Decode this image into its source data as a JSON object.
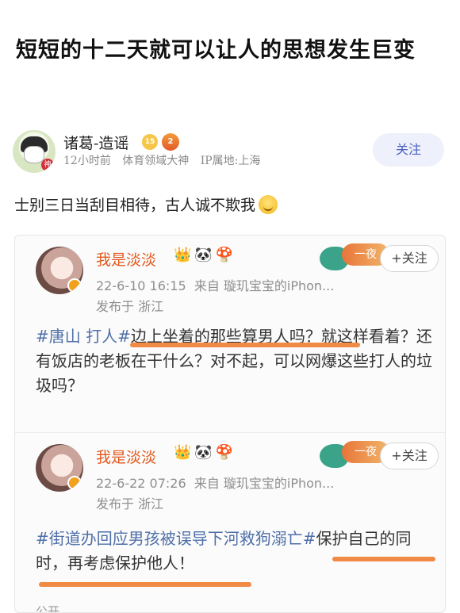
{
  "post": {
    "title": "短短的十二天就可以让人的思想发生巨变",
    "author": {
      "name": "诸葛-造谣",
      "level_badge": "15",
      "medal_badge": "2",
      "avatar_badge": "神",
      "time": "12小时前",
      "tag": "体育领域大神",
      "ip": "IP属地:上海"
    },
    "follow_label": "关注",
    "body": "士别三日当刮目相待，古人诚不欺我"
  },
  "screenshot": {
    "posts": [
      {
        "name": "我是淡淡",
        "icons": "👑🐼🍄",
        "date": "22-6-10 16:15",
        "source": "来自 璇玑宝宝的iPhon...",
        "location": "发布于 浙江",
        "banner": "一夜",
        "follow": "+关注",
        "hashtag": "#唐山 打人#",
        "text": "边上坐着的那些算男人吗？就这样看着？还有饭店的老板在干什么？对不起，可以网爆这些打人的垃圾吗？"
      },
      {
        "name": "我是淡淡",
        "icons": "👑🐼🍄",
        "date": "22-6-22 07:26",
        "source": "来自 璇玑宝宝的iPhon...",
        "location": "发布于 浙江",
        "banner": "一夜",
        "follow": "+关注",
        "hashtag": "#街道办回应男孩被误导下河救狗溺亡#",
        "text": "保护自己的同时，再考虑保护他人！",
        "bottom": "公开"
      }
    ]
  },
  "colors": {
    "accent": "#4a5fc1",
    "underline": "#f08a45",
    "weibo_name": "#e2591f"
  },
  "icons": {
    "avatar": "cartoon-avatar",
    "level": "level-badge",
    "medal": "medal-badge",
    "emoji": "smile-emoji"
  }
}
